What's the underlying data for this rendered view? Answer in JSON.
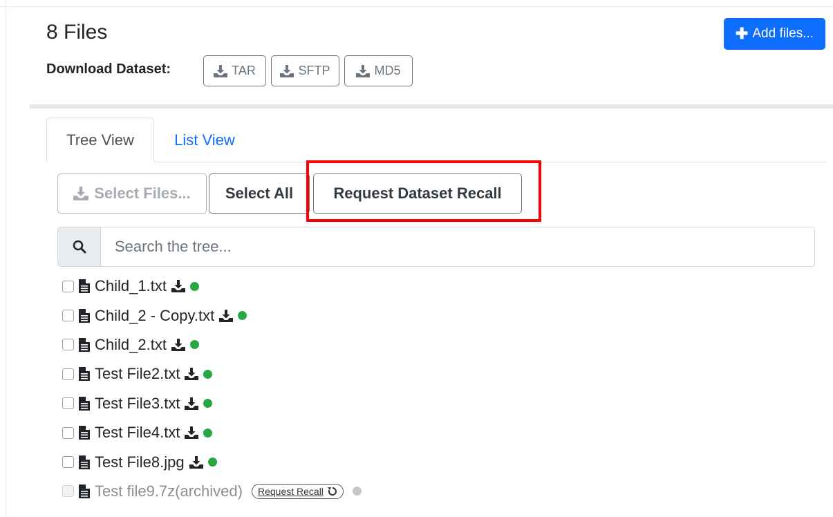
{
  "header": {
    "title": "8 Files",
    "add_files_label": "Add files..."
  },
  "download": {
    "label": "Download Dataset:",
    "buttons": [
      {
        "label": "TAR"
      },
      {
        "label": "SFTP"
      },
      {
        "label": "MD5"
      }
    ]
  },
  "tabs": [
    {
      "label": "Tree View",
      "active": true
    },
    {
      "label": "List View",
      "active": false
    }
  ],
  "toolbar": {
    "select_files_label": "Select Files...",
    "select_all_label": "Select All",
    "request_recall_label": "Request Dataset Recall"
  },
  "search": {
    "placeholder": "Search the tree..."
  },
  "files": [
    {
      "name": "Child_1.txt"
    },
    {
      "name": "Child_2 - Copy.txt"
    },
    {
      "name": "Child_2.txt"
    },
    {
      "name": "Test File2.txt"
    },
    {
      "name": "Test File3.txt"
    },
    {
      "name": "Test File4.txt"
    },
    {
      "name": "Test File8.jpg"
    }
  ],
  "archived_file": {
    "name": "Test file9.7z(archived)",
    "recall_label": "Request Recall"
  },
  "colors": {
    "primary": "#0d6efd",
    "online": "#28a745",
    "offline": "#c8c8c8",
    "highlight": "#ff0000"
  },
  "icons": {
    "add": "plus-icon",
    "download": "download-icon",
    "search": "search-icon",
    "file": "file-text-icon",
    "recall": "undo-icon",
    "status": "status-dot-icon"
  }
}
